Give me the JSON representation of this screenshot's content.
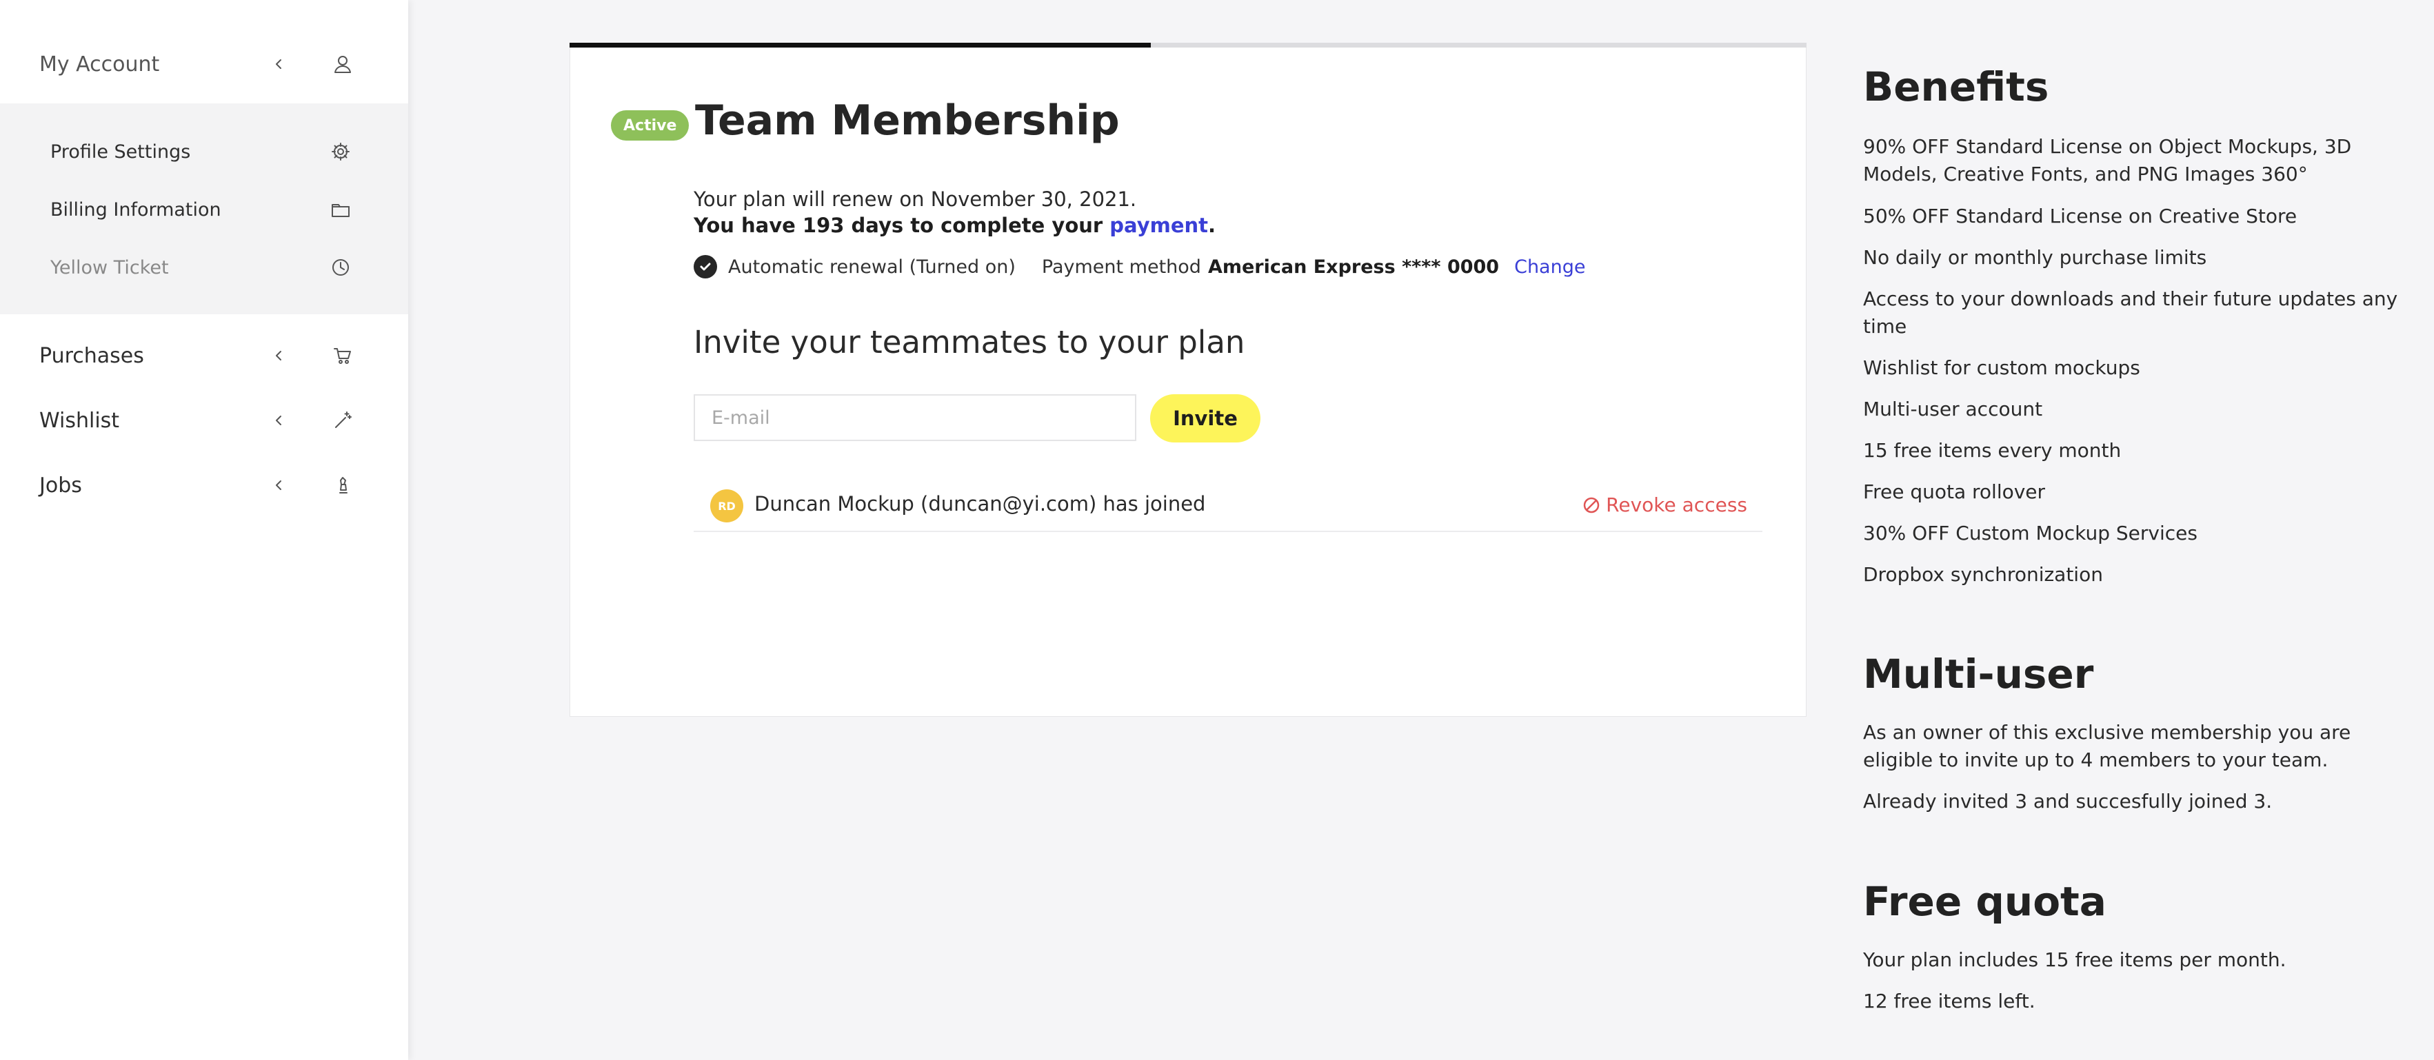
{
  "sidebar": {
    "my_account": "My Account",
    "sub_items": [
      {
        "label": "Profile Settings",
        "icon": "gear-icon"
      },
      {
        "label": "Billing Information",
        "icon": "folder-icon"
      },
      {
        "label": "Yellow Ticket",
        "icon": "clock-icon"
      }
    ],
    "purchases": "Purchases",
    "wishlist": "Wishlist",
    "jobs": "Jobs"
  },
  "progress": {
    "fraction": 0.47
  },
  "membership": {
    "badge": "Active",
    "title": "Team Membership",
    "renew_text": "Your plan will renew on November 30, 2021.",
    "days_prefix": "You have 193 days to complete your ",
    "days_link": "payment",
    "days_suffix": ".",
    "auto_renewal": "Automatic renewal (Turned on)",
    "payment_label": "Payment method",
    "payment_value": "American Express **** 0000",
    "change_label": "Change",
    "invite_heading": "Invite your teammates to your plan",
    "email_placeholder": "E-mail",
    "invite_button": "Invite",
    "members": [
      {
        "initials": "RD",
        "text": "Duncan Mockup (duncan@yi.com) has joined",
        "revoke": "Revoke access"
      }
    ]
  },
  "benefits": {
    "title": "Benefits",
    "items": [
      "90% OFF Standard License on Object Mockups, 3D Models, Creative Fonts, and PNG Images 360°",
      "50% OFF Standard License on Creative Store",
      "No daily or monthly purchase limits",
      "Access to your downloads and their future updates any time",
      "Wishlist for custom mockups",
      "Multi-user account",
      "15 free items every month",
      "Free quota rollover",
      "30% OFF Custom Mockup Services",
      "Dropbox synchronization"
    ]
  },
  "multiuser": {
    "title": "Multi-user",
    "text1": "As an owner of this exclusive membership you are eligible to invite up to 4 members to your team.",
    "text2": "Already invited 3 and succesfully joined 3."
  },
  "quota": {
    "title": "Free quota",
    "text1": "Your plan includes 15 free items per month.",
    "text2": "12 free items left."
  },
  "colors": {
    "accent_link": "#3a3fd6",
    "badge_green": "#8ec05a",
    "invite_yellow": "#fdf45a",
    "revoke_red": "#e05555"
  }
}
